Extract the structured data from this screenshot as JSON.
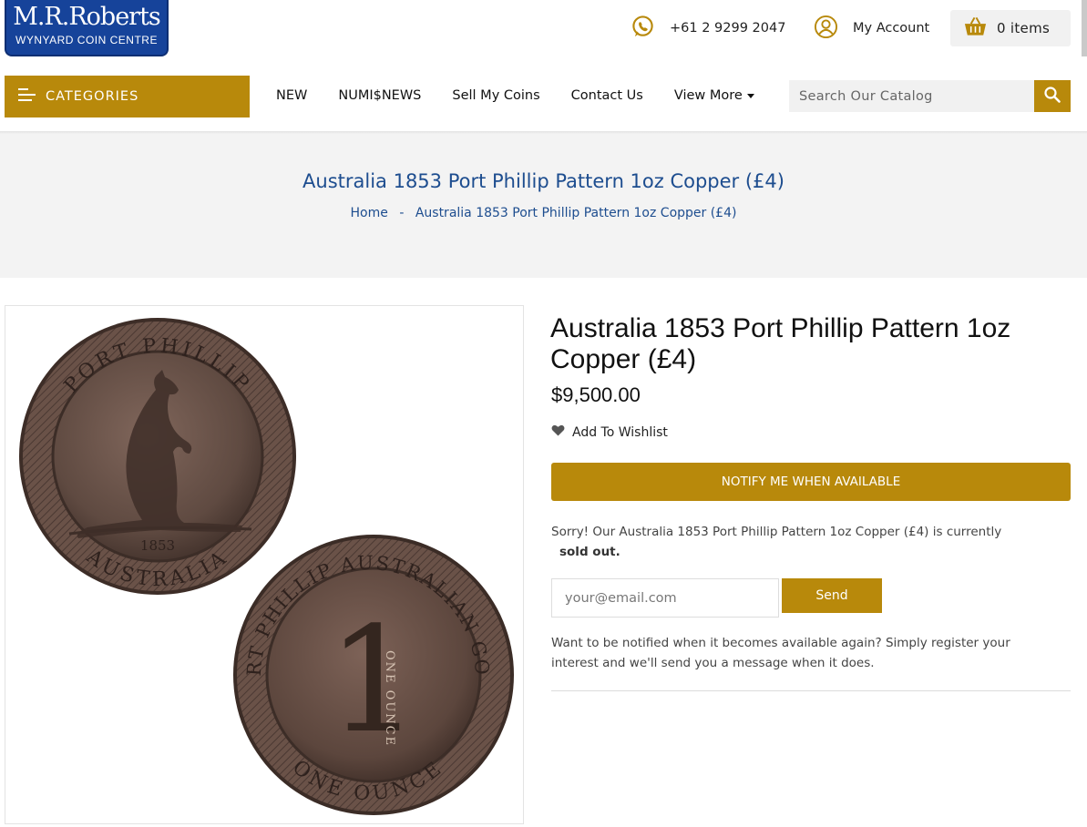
{
  "header": {
    "logo_main": "M.R.Roberts",
    "logo_sub": "WYNYARD COIN CENTRE",
    "phone": "+61 2 9299 2047",
    "account_label": "My Account",
    "cart_label": "0 items"
  },
  "nav": {
    "categories_label": "CATEGORIES",
    "items": [
      "NEW",
      "NUMI$NEWS",
      "Sell My Coins",
      "Contact Us",
      "View More"
    ],
    "search_placeholder": "Search Our Catalog"
  },
  "page_header": {
    "title": "Australia 1853 Port Phillip Pattern 1oz Copper (£4)",
    "breadcrumb_home": "Home",
    "breadcrumb_sep": "-",
    "breadcrumb_current": "Australia 1853 Port Phillip Pattern 1oz Copper (£4)"
  },
  "product": {
    "title": "Australia 1853 Port Phillip Pattern 1oz Copper (£4)",
    "price": "$9,500.00",
    "wishlist_label": "Add To Wishlist",
    "notify_button": "NOTIFY ME WHEN AVAILABLE",
    "sold_out_text": "Sorry! Our Australia 1853 Port Phillip Pattern 1oz Copper (£4) is currently",
    "sold_out_bold": "sold out.",
    "email_placeholder": "your@email.com",
    "send_label": "Send",
    "notice": "Want to be notified when it becomes available again? Simply register your interest and we'll send you a message when it does.",
    "coin_obverse": {
      "legend": "PORT PHILLIP",
      "bottom": "AUSTRALIA",
      "year": "1853"
    },
    "coin_reverse": {
      "legend": "PORT PHILLIP AUSTRALIAN GOLD",
      "bottom": "ONE OUNCE",
      "numeral": "1",
      "inner": "ONE OUNCE"
    }
  },
  "colors": {
    "gold": "#b8890b",
    "blue_title": "#1d4d8f",
    "logo_blue": "#16439a",
    "copper": "#6b4f43"
  }
}
